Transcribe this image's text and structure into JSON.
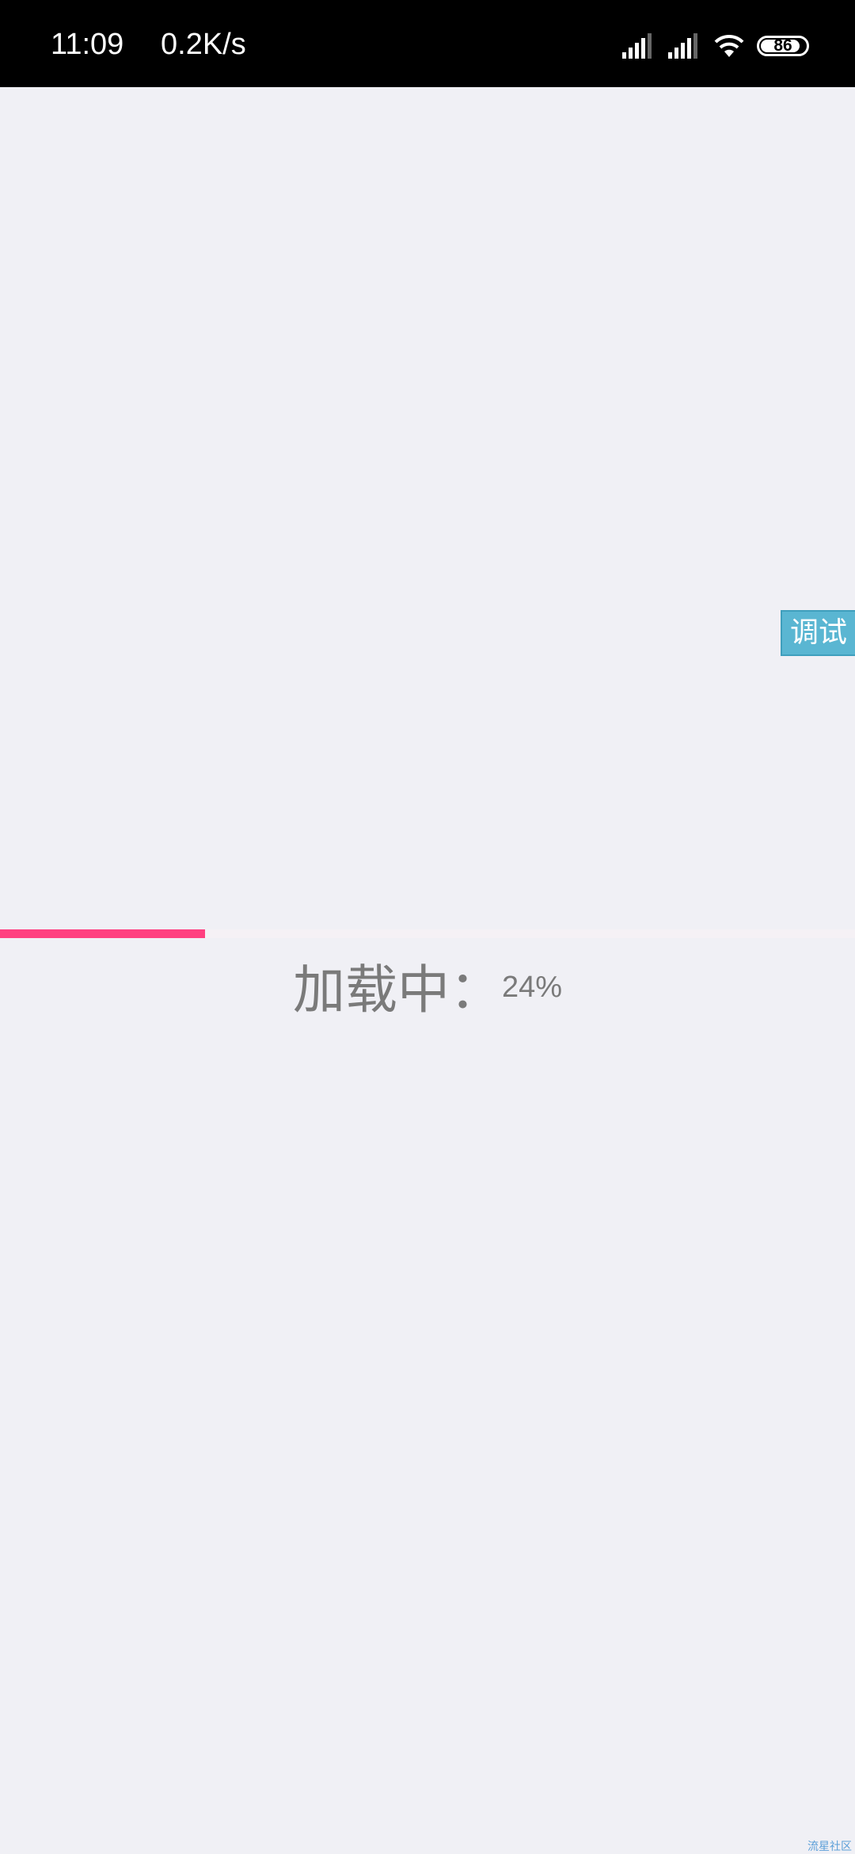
{
  "status_bar": {
    "time": "11:09",
    "network_speed": "0.2K/s",
    "battery_level": "86",
    "icons": [
      "signal-icon",
      "signal-icon",
      "wifi-icon",
      "battery-icon"
    ]
  },
  "debug_button": {
    "label": "调试"
  },
  "loading": {
    "label": "加载中：",
    "percent_text": "24%",
    "progress": 0.24,
    "progress_color": "#ff4080"
  },
  "watermark": {
    "text": "流星社区"
  },
  "colors": {
    "background": "#f0f0f5",
    "debug_button": "#5ab6d2",
    "status_bar": "#000000"
  }
}
